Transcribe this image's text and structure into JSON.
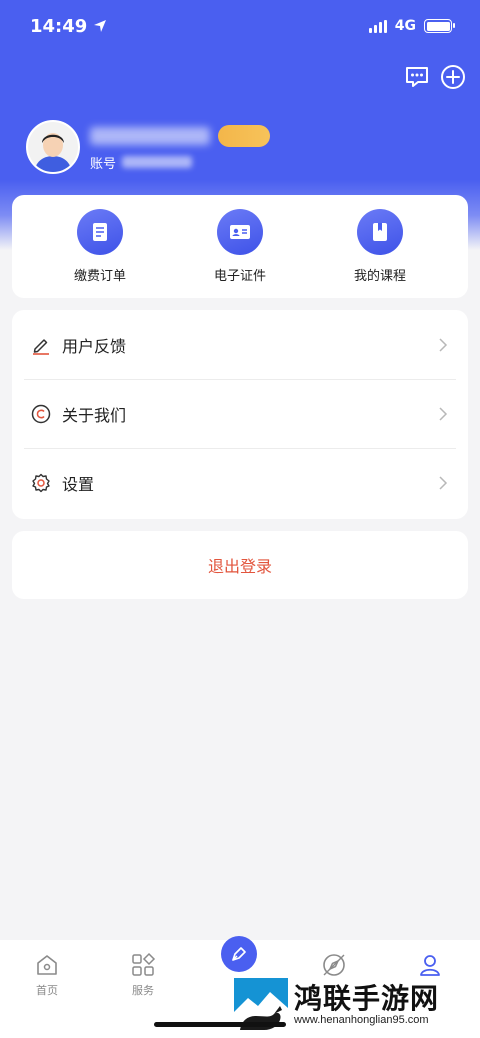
{
  "status_bar": {
    "time": "14:49",
    "network": "4G"
  },
  "header": {
    "icons": [
      "message-dots-icon",
      "plus-circle-icon"
    ]
  },
  "profile": {
    "vip_badge": "",
    "account_label": "账号"
  },
  "quick_actions": [
    {
      "label": "缴费订单",
      "icon": "order-doc-icon"
    },
    {
      "label": "电子证件",
      "icon": "id-card-icon"
    },
    {
      "label": "我的课程",
      "icon": "course-book-icon"
    }
  ],
  "menu": [
    {
      "label": "用户反馈",
      "icon": "pencil-icon"
    },
    {
      "label": "关于我们",
      "icon": "copyright-icon"
    },
    {
      "label": "设置",
      "icon": "gear-icon"
    }
  ],
  "logout": {
    "label": "退出登录",
    "color": "#e2553d"
  },
  "tabbar": [
    {
      "label": "首页",
      "icon": "home-icon"
    },
    {
      "label": "服务",
      "icon": "grid-icon"
    },
    {
      "label": "",
      "icon": "pen-icon"
    },
    {
      "label": "",
      "icon": "compass-icon"
    },
    {
      "label": "",
      "icon": "user-icon"
    }
  ],
  "watermark": {
    "title": "鸿联手游网",
    "url": "www.henanhonglian95.com"
  },
  "colors": {
    "primary": "#4a5ff0",
    "accent": "#e2553d"
  }
}
